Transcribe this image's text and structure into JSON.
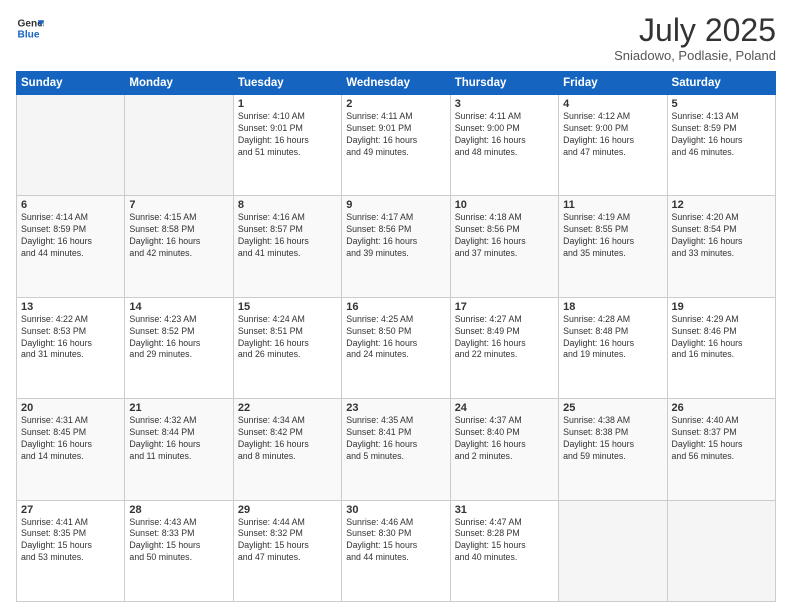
{
  "header": {
    "logo_line1": "General",
    "logo_line2": "Blue",
    "month": "July 2025",
    "location": "Sniadowo, Podlasie, Poland"
  },
  "weekdays": [
    "Sunday",
    "Monday",
    "Tuesday",
    "Wednesday",
    "Thursday",
    "Friday",
    "Saturday"
  ],
  "weeks": [
    [
      {
        "day": "",
        "content": ""
      },
      {
        "day": "",
        "content": ""
      },
      {
        "day": "1",
        "content": "Sunrise: 4:10 AM\nSunset: 9:01 PM\nDaylight: 16 hours\nand 51 minutes."
      },
      {
        "day": "2",
        "content": "Sunrise: 4:11 AM\nSunset: 9:01 PM\nDaylight: 16 hours\nand 49 minutes."
      },
      {
        "day": "3",
        "content": "Sunrise: 4:11 AM\nSunset: 9:00 PM\nDaylight: 16 hours\nand 48 minutes."
      },
      {
        "day": "4",
        "content": "Sunrise: 4:12 AM\nSunset: 9:00 PM\nDaylight: 16 hours\nand 47 minutes."
      },
      {
        "day": "5",
        "content": "Sunrise: 4:13 AM\nSunset: 8:59 PM\nDaylight: 16 hours\nand 46 minutes."
      }
    ],
    [
      {
        "day": "6",
        "content": "Sunrise: 4:14 AM\nSunset: 8:59 PM\nDaylight: 16 hours\nand 44 minutes."
      },
      {
        "day": "7",
        "content": "Sunrise: 4:15 AM\nSunset: 8:58 PM\nDaylight: 16 hours\nand 42 minutes."
      },
      {
        "day": "8",
        "content": "Sunrise: 4:16 AM\nSunset: 8:57 PM\nDaylight: 16 hours\nand 41 minutes."
      },
      {
        "day": "9",
        "content": "Sunrise: 4:17 AM\nSunset: 8:56 PM\nDaylight: 16 hours\nand 39 minutes."
      },
      {
        "day": "10",
        "content": "Sunrise: 4:18 AM\nSunset: 8:56 PM\nDaylight: 16 hours\nand 37 minutes."
      },
      {
        "day": "11",
        "content": "Sunrise: 4:19 AM\nSunset: 8:55 PM\nDaylight: 16 hours\nand 35 minutes."
      },
      {
        "day": "12",
        "content": "Sunrise: 4:20 AM\nSunset: 8:54 PM\nDaylight: 16 hours\nand 33 minutes."
      }
    ],
    [
      {
        "day": "13",
        "content": "Sunrise: 4:22 AM\nSunset: 8:53 PM\nDaylight: 16 hours\nand 31 minutes."
      },
      {
        "day": "14",
        "content": "Sunrise: 4:23 AM\nSunset: 8:52 PM\nDaylight: 16 hours\nand 29 minutes."
      },
      {
        "day": "15",
        "content": "Sunrise: 4:24 AM\nSunset: 8:51 PM\nDaylight: 16 hours\nand 26 minutes."
      },
      {
        "day": "16",
        "content": "Sunrise: 4:25 AM\nSunset: 8:50 PM\nDaylight: 16 hours\nand 24 minutes."
      },
      {
        "day": "17",
        "content": "Sunrise: 4:27 AM\nSunset: 8:49 PM\nDaylight: 16 hours\nand 22 minutes."
      },
      {
        "day": "18",
        "content": "Sunrise: 4:28 AM\nSunset: 8:48 PM\nDaylight: 16 hours\nand 19 minutes."
      },
      {
        "day": "19",
        "content": "Sunrise: 4:29 AM\nSunset: 8:46 PM\nDaylight: 16 hours\nand 16 minutes."
      }
    ],
    [
      {
        "day": "20",
        "content": "Sunrise: 4:31 AM\nSunset: 8:45 PM\nDaylight: 16 hours\nand 14 minutes."
      },
      {
        "day": "21",
        "content": "Sunrise: 4:32 AM\nSunset: 8:44 PM\nDaylight: 16 hours\nand 11 minutes."
      },
      {
        "day": "22",
        "content": "Sunrise: 4:34 AM\nSunset: 8:42 PM\nDaylight: 16 hours\nand 8 minutes."
      },
      {
        "day": "23",
        "content": "Sunrise: 4:35 AM\nSunset: 8:41 PM\nDaylight: 16 hours\nand 5 minutes."
      },
      {
        "day": "24",
        "content": "Sunrise: 4:37 AM\nSunset: 8:40 PM\nDaylight: 16 hours\nand 2 minutes."
      },
      {
        "day": "25",
        "content": "Sunrise: 4:38 AM\nSunset: 8:38 PM\nDaylight: 15 hours\nand 59 minutes."
      },
      {
        "day": "26",
        "content": "Sunrise: 4:40 AM\nSunset: 8:37 PM\nDaylight: 15 hours\nand 56 minutes."
      }
    ],
    [
      {
        "day": "27",
        "content": "Sunrise: 4:41 AM\nSunset: 8:35 PM\nDaylight: 15 hours\nand 53 minutes."
      },
      {
        "day": "28",
        "content": "Sunrise: 4:43 AM\nSunset: 8:33 PM\nDaylight: 15 hours\nand 50 minutes."
      },
      {
        "day": "29",
        "content": "Sunrise: 4:44 AM\nSunset: 8:32 PM\nDaylight: 15 hours\nand 47 minutes."
      },
      {
        "day": "30",
        "content": "Sunrise: 4:46 AM\nSunset: 8:30 PM\nDaylight: 15 hours\nand 44 minutes."
      },
      {
        "day": "31",
        "content": "Sunrise: 4:47 AM\nSunset: 8:28 PM\nDaylight: 15 hours\nand 40 minutes."
      },
      {
        "day": "",
        "content": ""
      },
      {
        "day": "",
        "content": ""
      }
    ]
  ]
}
